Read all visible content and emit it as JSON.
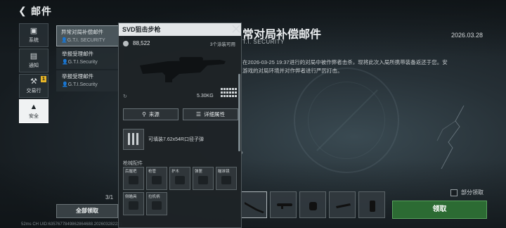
{
  "header": {
    "title": "邮件",
    "back_icon": "back-arrow-icon"
  },
  "nav": {
    "items": [
      {
        "label": "系统",
        "icon": "monitor-icon",
        "active": false,
        "badge": ""
      },
      {
        "label": "通知",
        "icon": "document-icon",
        "active": false,
        "badge": ""
      },
      {
        "label": "交易行",
        "icon": "hammer-icon",
        "active": false,
        "badge": "1"
      },
      {
        "label": "安全",
        "icon": "warning-icon",
        "active": true,
        "badge": ""
      }
    ]
  },
  "mail_list": {
    "items": [
      {
        "subject": "异常对局补偿邮件",
        "sender": "G.T.I. SECURITY",
        "active": true
      },
      {
        "subject": "举报受理邮件",
        "sender": "G.T.I.Security",
        "active": false
      },
      {
        "subject": "举报受理邮件",
        "sender": "G.T.I.Security",
        "active": false
      }
    ],
    "count": "3/1",
    "claim_all": "全部领取"
  },
  "status_line": "52ms   CH UID:6357677849862864688.202603282221",
  "mail": {
    "title": "异常对局补偿邮件",
    "title_visible": "常对局补偿邮件",
    "from": "T.I. SECURITY",
    "date": "2026.03.28",
    "body_line1": "在2026-03-25 19:37进行的对局中被作弊者击杀，现将此次入局所携带装备返还于您。安",
    "body_line2": "游戏的对局环境并对作弊者进行严厉打击。"
  },
  "attachments": {
    "items": [
      "rifle-icon",
      "scope-icon",
      "silencer-icon",
      "magazine-icon",
      "stock-icon",
      "grip-icon"
    ],
    "partial_label": "部分领取",
    "claim_label": "领取"
  },
  "popup": {
    "title": "SVD狙击步枪",
    "price": "88,522",
    "skins": "3个涂装可用",
    "weight": "5.30KG",
    "source_btn": "来源",
    "details_btn": "详细属性",
    "ammo": "可填装7.62x54R口径子弹",
    "section": "枪械配件",
    "slots": [
      "后握把",
      "枪管",
      "护木",
      "弹匣",
      "瞄准镜",
      "侧瞄具",
      "拉机柄"
    ]
  },
  "colors": {
    "accent_green": "#2c6b33",
    "badge_yellow": "#e8b627"
  }
}
